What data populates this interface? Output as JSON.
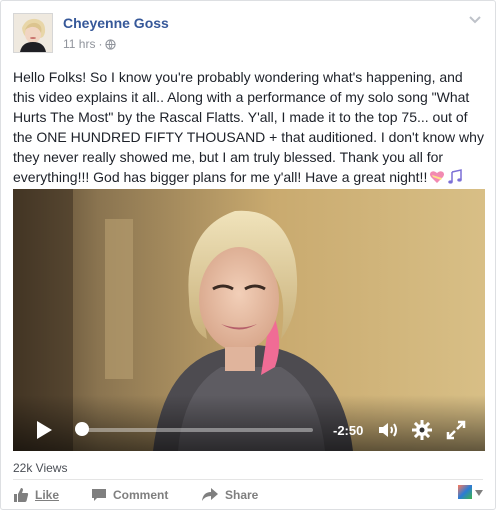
{
  "post": {
    "author": "Cheyenne Goss",
    "timestamp": "11 hrs",
    "separator": "·",
    "audience_icon": "globe-icon",
    "text": "Hello Folks! So I know you're probably wondering what's happening, and this video explains it all.. Along with a performance of my solo song \"What Hurts The Most\" by the Rascal Flatts. Y'all, I made it to the top 75... out of the ONE HUNDRED FIFTY THOUSAND + that auditioned. I don't know why they never really showed me, but I am truly blessed. Thank you all for everything!!! God has bigger plans for me y'all! Have a great night!!",
    "emoji": [
      "heart-with-ribbon-icon",
      "musical-notes-icon"
    ]
  },
  "video": {
    "time_remaining": "-2:50",
    "progress": 0.02
  },
  "stats": {
    "views": "22k Views"
  },
  "actions": {
    "like": "Like",
    "comment": "Comment",
    "share": "Share"
  },
  "colors": {
    "author_link": "#365899",
    "meta_gray": "#90949c",
    "action_gray": "#7f7f7f"
  }
}
